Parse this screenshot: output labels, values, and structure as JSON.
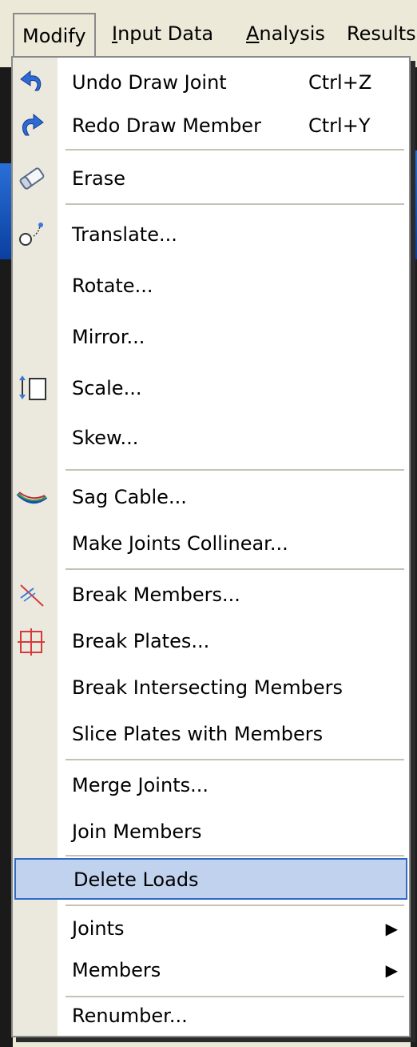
{
  "menubar": {
    "modify": "Modify",
    "input_data_first": "I",
    "input_data_rest": "nput Data",
    "analysis_first": "A",
    "analysis_rest": "nalysis",
    "results": "Results"
  },
  "menu": {
    "undo": {
      "label": "Undo Draw Joint",
      "shortcut": "Ctrl+Z",
      "icon": "undo-icon"
    },
    "redo": {
      "label": "Redo Draw Member",
      "shortcut": "Ctrl+Y",
      "icon": "redo-icon"
    },
    "erase": {
      "label": "Erase",
      "icon": "eraser-icon"
    },
    "translate": {
      "label": "Translate...",
      "icon": "translate-icon"
    },
    "rotate": {
      "label": "Rotate..."
    },
    "mirror": {
      "label": "Mirror..."
    },
    "scale": {
      "label": "Scale...",
      "icon": "scale-icon"
    },
    "skew": {
      "label": "Skew..."
    },
    "sag_cable": {
      "label": "Sag Cable...",
      "icon": "sag-cable-icon"
    },
    "make_collinear": {
      "label": "Make Joints Collinear..."
    },
    "break_members": {
      "label": "Break Members...",
      "icon": "break-members-icon"
    },
    "break_plates": {
      "label": "Break Plates...",
      "icon": "break-plates-icon"
    },
    "break_intersecting": {
      "label": "Break Intersecting Members"
    },
    "slice_plates": {
      "label": "Slice Plates with Members"
    },
    "merge_joints": {
      "label": "Merge Joints..."
    },
    "join_members": {
      "label": "Join Members"
    },
    "delete_loads": {
      "label": "Delete Loads"
    },
    "joints": {
      "label": "Joints"
    },
    "members": {
      "label": "Members"
    },
    "renumber": {
      "label": "Renumber..."
    }
  },
  "colors": {
    "highlight_bg": "#c1d2ee",
    "highlight_border": "#316ac5",
    "gutter": "#ebe9de",
    "menubar": "#ece9d8"
  }
}
